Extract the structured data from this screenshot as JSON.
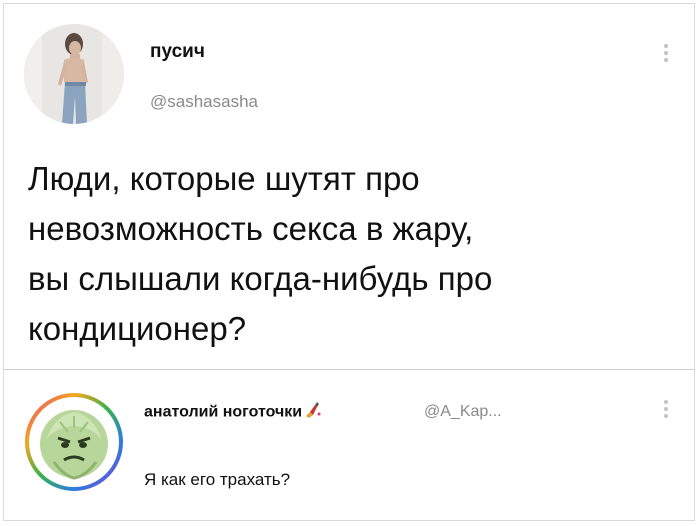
{
  "post": {
    "display_name": "пусич",
    "handle": "@sashasasha",
    "lines": [
      "Люди, которые шутят про",
      "невозможность секса в жару,",
      "вы слышали когда-нибудь про",
      "кондиционер?"
    ]
  },
  "reply": {
    "display_name": "анатолий ноготочки",
    "handle": "@A_Kap...",
    "text": "Я как его трахать?"
  }
}
